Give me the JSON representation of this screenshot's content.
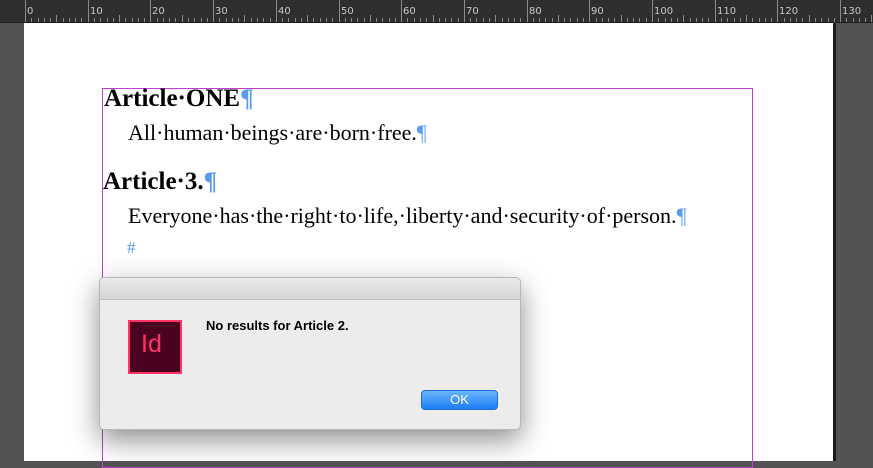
{
  "ruler": {
    "labels": [
      "0",
      "10",
      "20",
      "30",
      "40",
      "50",
      "60",
      "70",
      "80",
      "90",
      "100",
      "110",
      "120",
      "130"
    ]
  },
  "document": {
    "heading1": "Article·ONE",
    "body1": "All·human·beings·are·born·free.",
    "heading2": "Article·3.",
    "body2": "Everyone·has·the·right·to·life,·liberty·and·security·of·person.",
    "pilcrow": "¶",
    "end_marker": "#"
  },
  "dialog": {
    "app_icon_text": "Id",
    "message": "No results for Article 2.",
    "ok_label": "OK"
  },
  "colors": {
    "frame_border": "#c23dd6",
    "hidden_chars": "#5a9bef",
    "indesign_brand": "#ff3366",
    "ok_button": "#1b7ff5"
  }
}
